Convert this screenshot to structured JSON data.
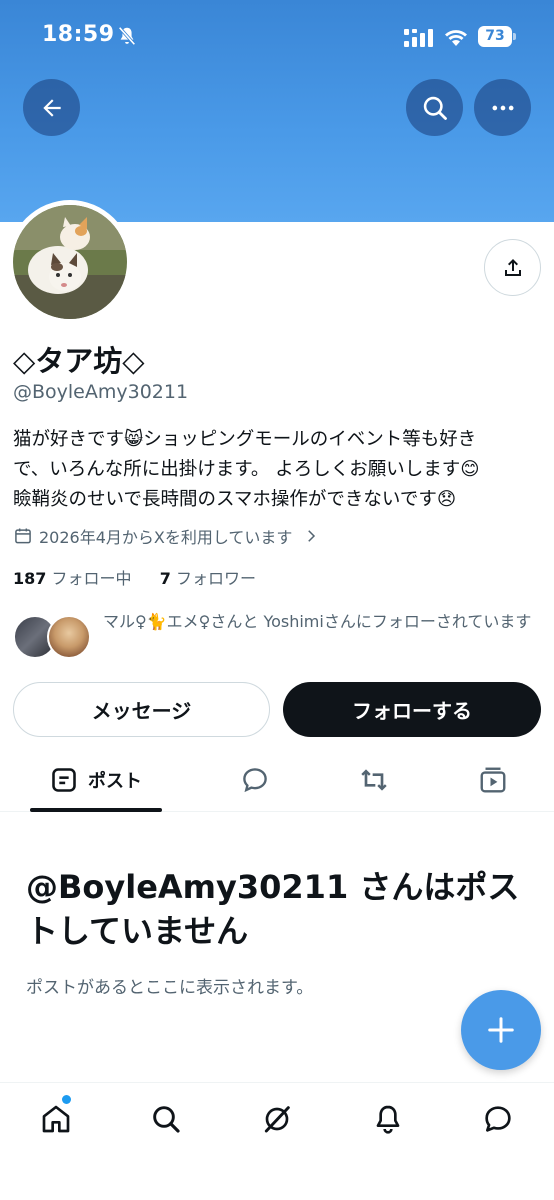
{
  "status_bar": {
    "time": "18:59",
    "battery": "73"
  },
  "header": {
    "back_icon": "arrow-left-icon",
    "search_icon": "search-icon",
    "more_icon": "more-horizontal-icon"
  },
  "profile": {
    "display_name": "◇タア坊◇",
    "handle": "@BoyleAmy30211",
    "bio_lines": [
      "猫が好きです😸ショッピングモールのイベント等も好き",
      "で、いろんな所に出掛けます。 よろしくお願いします😊",
      "瞼鞘炎のせいで長時間のスマホ操作ができないです😞"
    ],
    "joined": "2026年4月からXを利用しています",
    "following_count": "187",
    "following_label": "フォロー中",
    "followers_count": "7",
    "followers_label": "フォロワー",
    "followed_by_text": "マル♀🐈エメ♀さんと Yoshimiさんにフォローされています"
  },
  "actions": {
    "message_label": "メッセージ",
    "follow_label": "フォローする"
  },
  "tabs": {
    "posts_label": "ポスト"
  },
  "empty_state": {
    "title": "@BoyleAmy30211 さんはポストしていません",
    "subtitle": "ポストがあるとここに表示されます。"
  },
  "colors": {
    "banner": "#4a9ae8",
    "accent": "#1d9bf0",
    "text_primary": "#0f1419",
    "text_secondary": "#536471",
    "follow_button": "#0f1419"
  }
}
